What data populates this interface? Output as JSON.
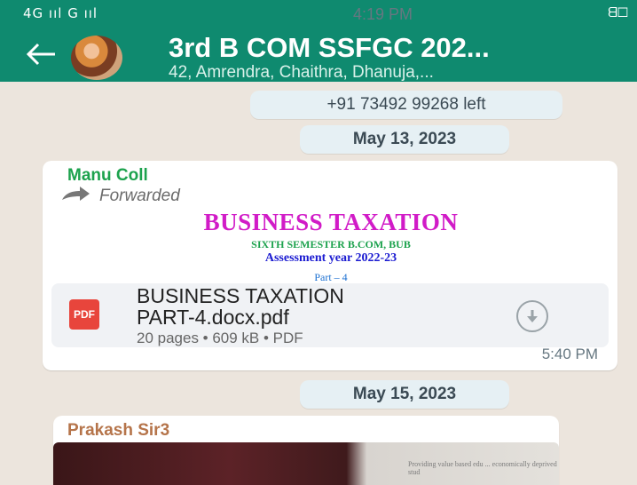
{
  "status_bar": {
    "network": "4G ııl G ııl",
    "time": "4:19 PM",
    "right": "ᗺ☐"
  },
  "header": {
    "title": "3rd B COM SSFGC 202...",
    "subtitle": "42, Amrendra, Chaithra, Dhanuja,..."
  },
  "system_message": "+91 73492 99268 left",
  "date_dividers": [
    "May 13, 2023",
    "May 15, 2023"
  ],
  "messages": [
    {
      "sender": "Manu Coll",
      "forwarded_label": "Forwarded",
      "preview": {
        "line1": "BUSINESS TAXATION",
        "line2": "SIXTH SEMESTER B.COM, BUB",
        "line3": "Assessment year 2022-23",
        "line4": "Part – 4"
      },
      "document": {
        "icon_label": "PDF",
        "name_line1": "BUSINESS TAXATION",
        "name_line2": "PART-4.docx.pdf",
        "meta": "20 pages • 609 kB • PDF"
      },
      "time": "5:40 PM"
    },
    {
      "sender": "Prakash Sir3",
      "photo_text": "Providing value based edu ... economically deprived stud"
    }
  ],
  "colors": {
    "header_bg": "#0f8a6f",
    "chat_bg": "#ece5dd",
    "sender1": "#1ca24d",
    "sender2": "#b5744a",
    "pdf_red": "#e8453c"
  }
}
